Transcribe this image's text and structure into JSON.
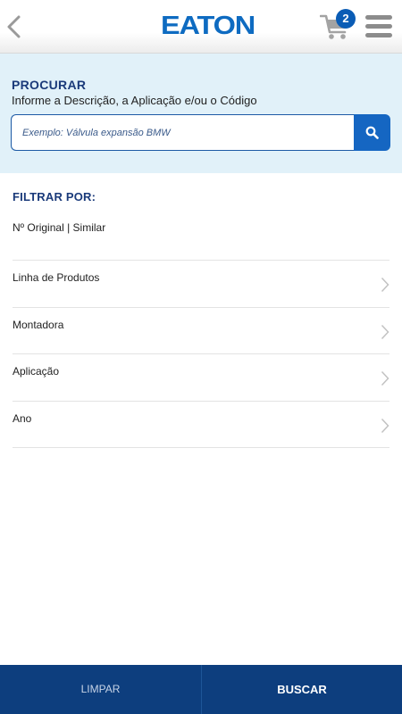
{
  "header": {
    "logo_text": "EATON",
    "cart_count": "2",
    "brand_color": "#0e6bc1"
  },
  "search": {
    "title": "PROCURAR",
    "subtitle": "Informe a Descrição, a Aplicação e/ou o Código",
    "placeholder": "Exemplo: Válvula expansão BMW",
    "value": ""
  },
  "filters": {
    "title": "FILTRAR POR:",
    "toggle_original": "Nº Original",
    "toggle_separator": " | ",
    "toggle_similar": "Similar",
    "items": [
      {
        "label": "Linha de Produtos"
      },
      {
        "label": "Montadora"
      },
      {
        "label": "Aplicação"
      },
      {
        "label": "Ano"
      }
    ]
  },
  "footer": {
    "clear_label": "LIMPAR",
    "search_label": "BUSCAR",
    "bar_color": "#0d3e7e"
  },
  "icons": [
    "back-chevron-icon",
    "cart-icon",
    "hamburger-menu-icon",
    "search-icon",
    "chevron-right-icon"
  ]
}
